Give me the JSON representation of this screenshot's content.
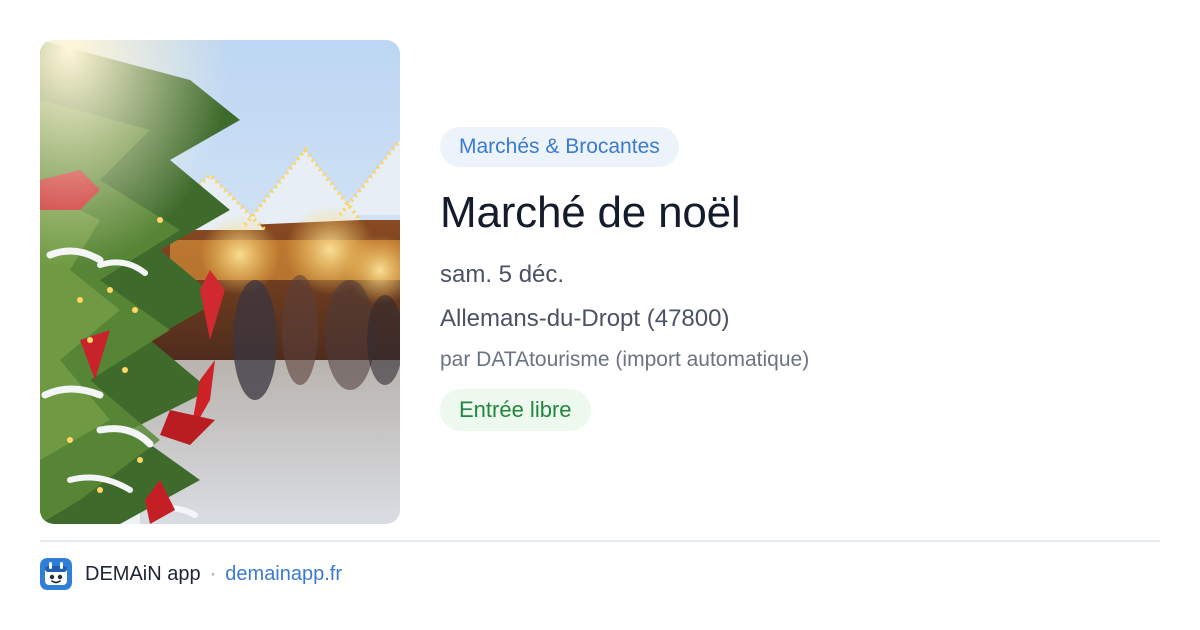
{
  "event": {
    "image_icon": "christmas-market-photo",
    "category": "Marchés & Brocantes",
    "title": "Marché de noël",
    "date": "sam. 5 déc.",
    "location": "Allemans-du-Dropt (47800)",
    "author": "par DATAtourisme (import automatique)",
    "price": "Entrée libre"
  },
  "footer": {
    "app_icon": "demain-app-icon",
    "app_name": "DEMAiN app",
    "separator": "·",
    "url": "demainapp.fr"
  },
  "colors": {
    "accent_blue": "#3a7bd0",
    "category_bg": "#edf3fb",
    "price_green": "#22873c",
    "price_bg": "#edf8ef",
    "title_text": "#141b2b",
    "divider": "#e6ebef"
  }
}
